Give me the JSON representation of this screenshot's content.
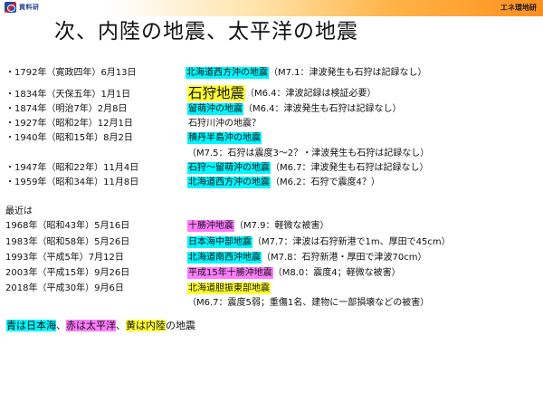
{
  "header": {
    "logo_text": "資料研",
    "right_label": "エネ環地研"
  },
  "title": "次、内陸の地震、太平洋の地震",
  "entries": [
    {
      "date": "・1792年（寛政四年）6月13日",
      "quake": "北海道西方沖の地震",
      "note": "（M7.1：津波発生も石狩は記録なし）",
      "color": "cyan"
    },
    {
      "date": "・1834年（天保五年）1月1日",
      "quake": "石狩地震",
      "note": "（M6.4：津波記録は検証必要）",
      "color": "yellow"
    },
    {
      "date": "・1874年（明治7年）2月8日",
      "quake": "留萌沖の地震",
      "note": "（M6.4：津波発生も石狩は記録なし）",
      "color": "cyan"
    },
    {
      "date": "・1927年（昭和2年）12月1日",
      "quake": "石狩川沖の地震？",
      "note": "",
      "color": "none"
    },
    {
      "date": "・1940年（昭和15年）8月2日",
      "quake": "積丹半島沖の地震",
      "note": "",
      "color": "cyan"
    },
    {
      "date": "",
      "quake": "",
      "note": "（M7.5：石狩は震度3～2？・津波発生も石狩は記録なし）",
      "color": "none"
    },
    {
      "date": "・1947年（昭和22年）11月4日",
      "quake": "石狩～留萌沖の地震",
      "note": "（M6.7：津波発生も石狩は記録なし）",
      "color": "cyan"
    },
    {
      "date": "・1959年（昭和34年）11月8日",
      "quake": "北海道西方沖の地震",
      "note": "（M6.2：石狩で震度4？）",
      "color": "cyan"
    }
  ],
  "recent": {
    "heading": "最近は",
    "entries": [
      {
        "date": "1968年（昭和43年）5月16日",
        "quake": "十勝沖地震",
        "note": "（M7.9：軽微な被害）",
        "color": "magenta"
      },
      {
        "date": "1983年（昭和58年）5月26日",
        "quake": "日本海中部地震",
        "note": "（M7.7：津波は石狩新港で1m、厚田で45cm）",
        "color": "cyan"
      },
      {
        "date": "1993年（平成5年）7月12日",
        "quake": "北海道南西沖地震",
        "note": "（M7.8：石狩新港・厚田で津波70cm）",
        "color": "cyan"
      },
      {
        "date": "2003年（平成15年）9月26日",
        "quake": "平成15年十勝沖地震",
        "note": "（M8.0：震度4；軽微な被害）",
        "color": "magenta"
      },
      {
        "date": "2018年（平成30年）9月6日",
        "quake": "北海道胆振東部地震",
        "note": "",
        "color": "yellow"
      },
      {
        "date": "",
        "quake": "",
        "note": "（M6.7：震度5弱；重傷1名、建物に一部損壊などの被害）",
        "color": "none"
      }
    ]
  },
  "legend": {
    "blue": "青は日本海",
    "sep1": "、",
    "red": "赤は太平洋",
    "sep2": "、",
    "yellow": "黄は内陸",
    "suffix": "の地震"
  },
  "colors": {
    "cyan": "#00f6ff",
    "magenta": "#ff7bff",
    "yellow": "#ffff33"
  }
}
